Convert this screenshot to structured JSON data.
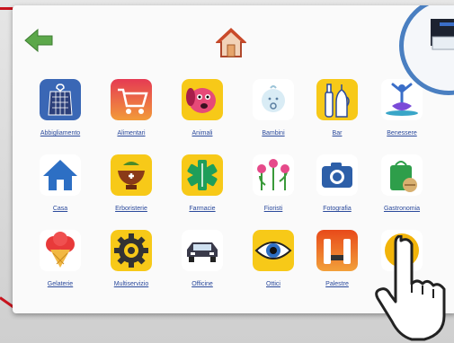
{
  "items": [
    {
      "label": "Abbigliamento",
      "icon": "clothing-icon"
    },
    {
      "label": "Alimentari",
      "icon": "cart-icon"
    },
    {
      "label": "Animali",
      "icon": "dog-icon"
    },
    {
      "label": "Bambini",
      "icon": "baby-icon"
    },
    {
      "label": "Bar",
      "icon": "bottles-icon"
    },
    {
      "label": "Benessere",
      "icon": "yoga-icon"
    },
    {
      "label": "Casa",
      "icon": "house-icon"
    },
    {
      "label": "Erboristerie",
      "icon": "herbal-icon"
    },
    {
      "label": "Farmacie",
      "icon": "pharmacy-icon"
    },
    {
      "label": "Fioristi",
      "icon": "flowers-icon"
    },
    {
      "label": "Fotografia",
      "icon": "camera-icon"
    },
    {
      "label": "Gastronomia",
      "icon": "gastronomy-icon"
    },
    {
      "label": "Gelaterie",
      "icon": "icecream-icon"
    },
    {
      "label": "Multiservizio",
      "icon": "gear-icon"
    },
    {
      "label": "Officine",
      "icon": "car-icon"
    },
    {
      "label": "Ottici",
      "icon": "eye-icon"
    },
    {
      "label": "Palestre",
      "icon": "gym-icon"
    }
  ]
}
